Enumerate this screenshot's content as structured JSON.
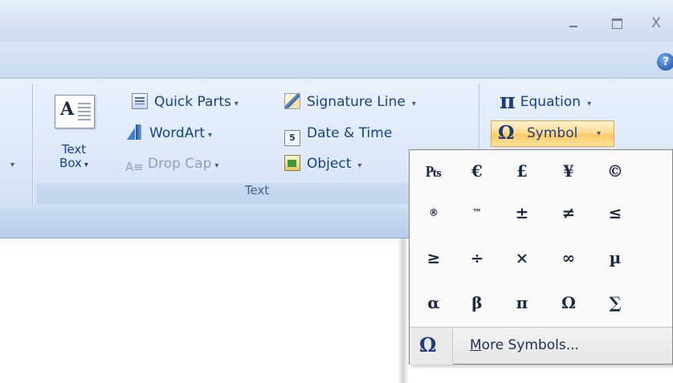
{
  "window": {
    "minimize_glyph": "_",
    "maximize_glyph": "",
    "close_glyph": "X"
  },
  "help": {
    "glyph": "?"
  },
  "text_group": {
    "label": "Text",
    "text_box": {
      "line1": "Text",
      "line2": "Box",
      "dropdown": "▾"
    },
    "quick_parts": "Quick Parts",
    "wordart": "WordArt",
    "drop_cap": "Drop Cap",
    "signature_line": "Signature Line",
    "date_time": "Date & Time",
    "date_icon_text": "5",
    "object": "Object",
    "dropdown_glyph": "▾",
    "textbox_icon_letter": "A"
  },
  "symbols_group": {
    "equation": "Equation",
    "equation_glyph": "π",
    "symbol": "Symbol",
    "symbol_glyph": "Ω"
  },
  "symbol_menu": {
    "symbols": [
      "₧",
      "€",
      "£",
      "¥",
      "©",
      "®",
      "™",
      "±",
      "≠",
      "≤",
      "≥",
      "÷",
      "×",
      "∞",
      "µ",
      "α",
      "β",
      "π",
      "Ω",
      "∑"
    ],
    "more_first": "M",
    "more_rest": "ore Symbols...",
    "footer_glyph": "Ω"
  },
  "colors": {
    "ribbon_text": "#15428b",
    "symbol_highlight": "#ffd98c"
  }
}
